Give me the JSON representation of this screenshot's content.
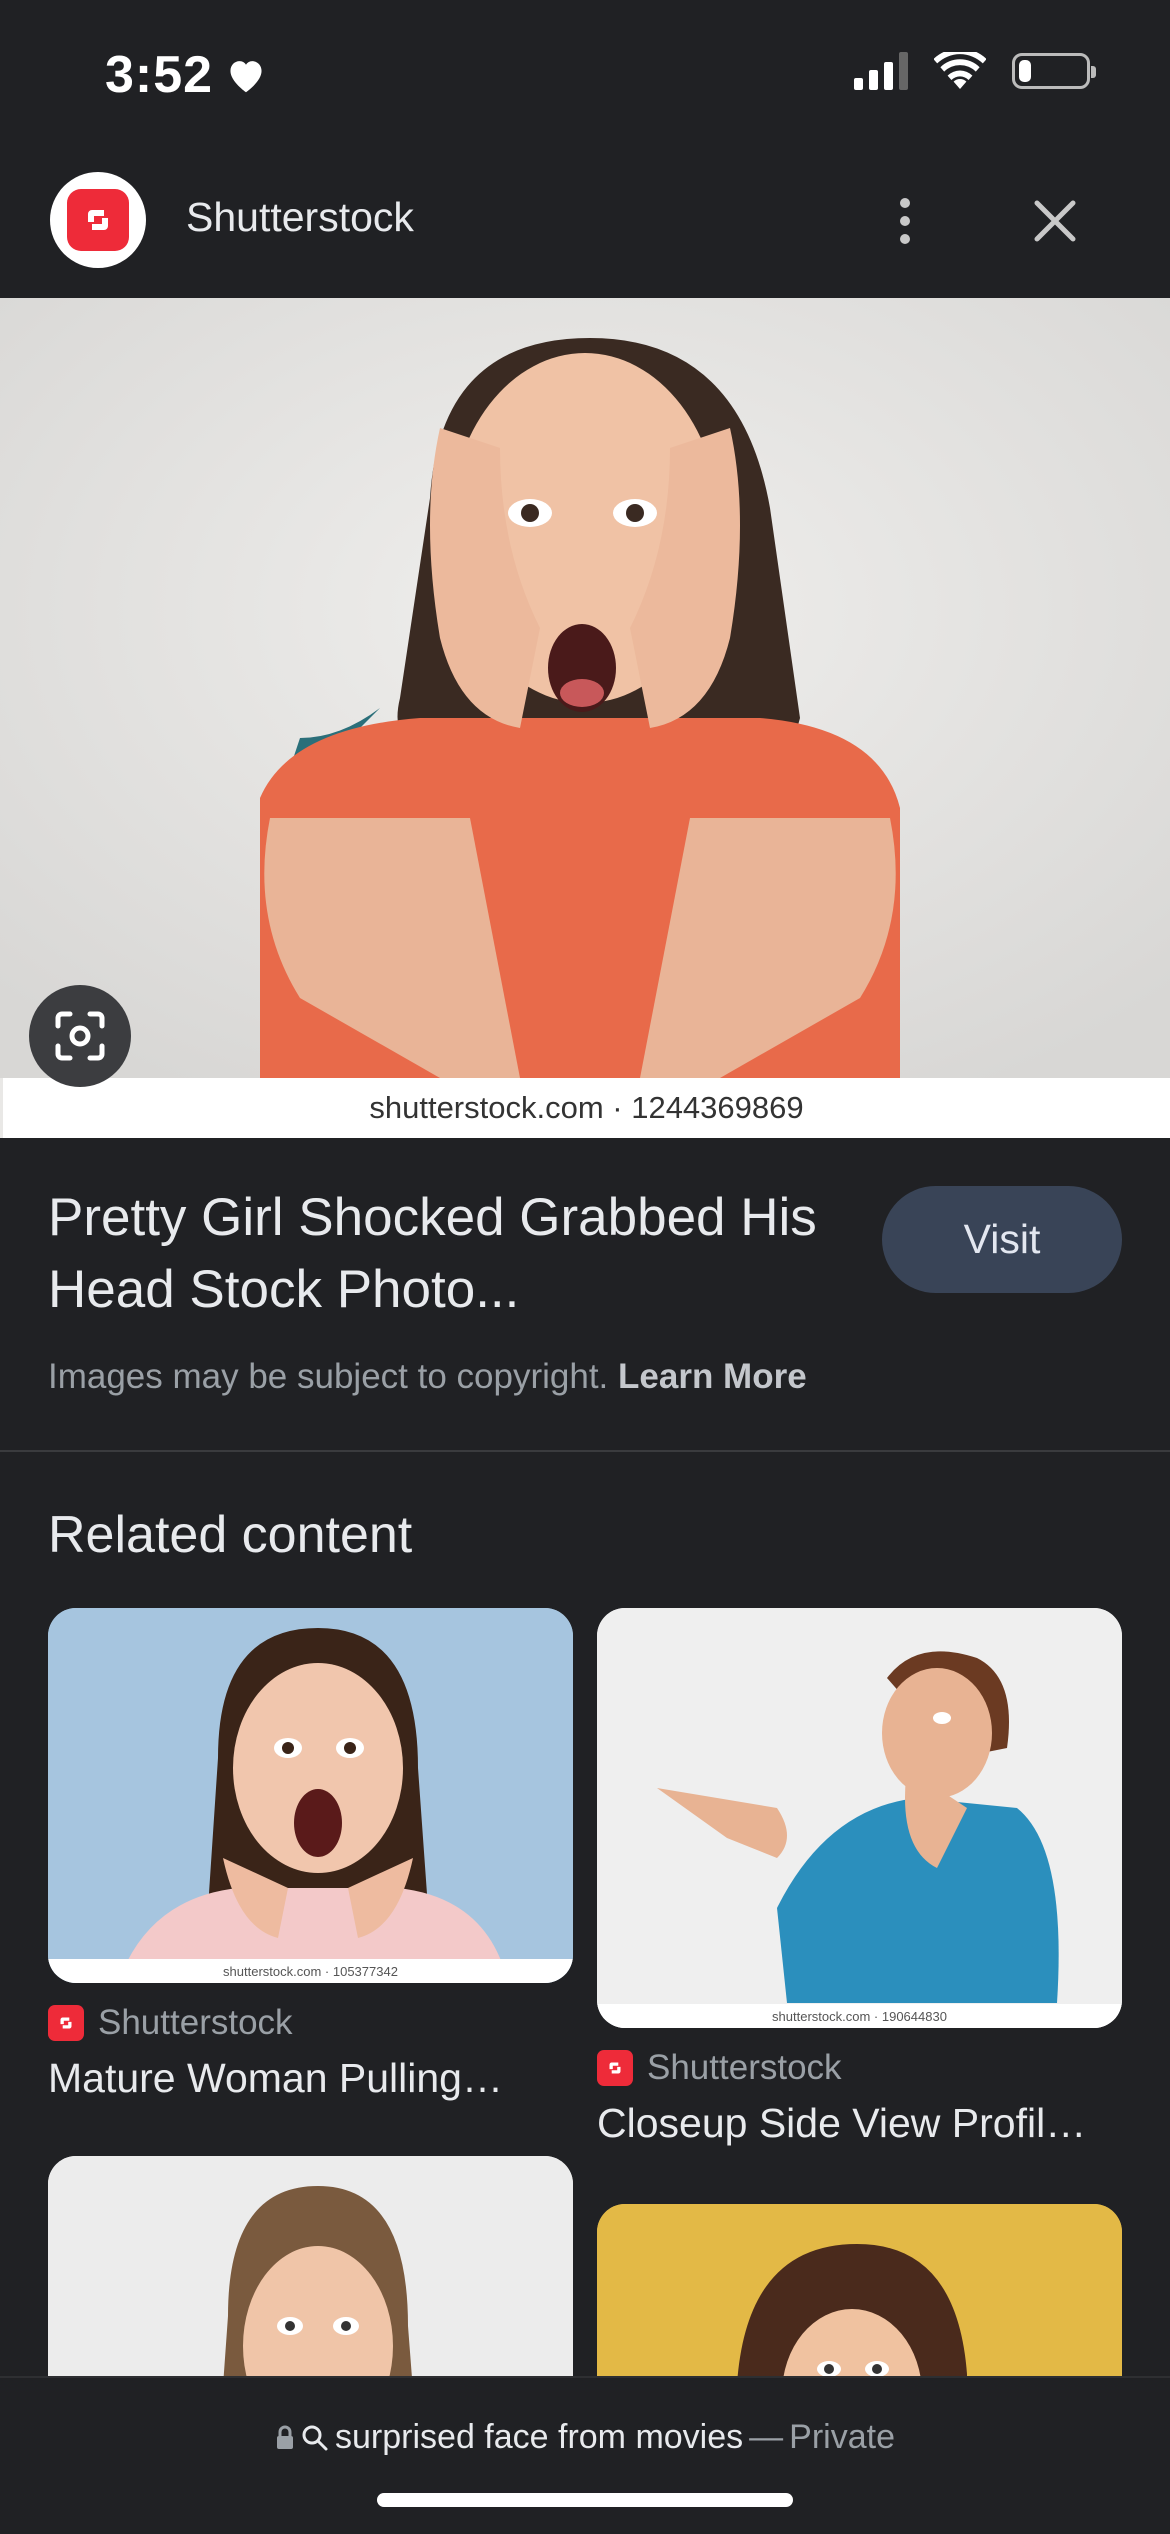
{
  "status_bar": {
    "time": "3:52",
    "battery_level": 0.2
  },
  "header": {
    "site_name": "Shutterstock",
    "menu_icon": "more-vertical-icon",
    "close_icon": "close-icon"
  },
  "main_image": {
    "watermark": "shutterstock.com · 1244369869",
    "lens_icon": "google-lens-icon"
  },
  "result": {
    "title": "Pretty Girl Shocked Grabbed His Head Stock Photo...",
    "visit_label": "Visit",
    "copyright_text": "Images may be subject to copyright.",
    "learn_more": "Learn More"
  },
  "related": {
    "heading": "Related content",
    "items": [
      {
        "watermark": "shutterstock.com · 105377342",
        "source": "Shutterstock",
        "title": "Mature Woman Pulling…"
      },
      {
        "watermark": "shutterstock.com · 190644830",
        "source": "Shutterstock",
        "title": "Closeup Side View Profil…"
      }
    ]
  },
  "bottom_bar": {
    "query": "surprised face from movies",
    "separator": "—",
    "mode": "Private"
  },
  "colors": {
    "background": "#202124",
    "accent_brand": "#ee2b39",
    "visit_button": "#394457"
  }
}
